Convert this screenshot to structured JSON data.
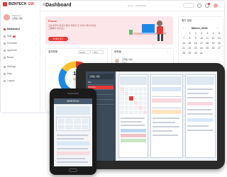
{
  "app": {
    "brand": "BIZNTECH",
    "brand_accent": "GW",
    "page_title": "Dashboard",
    "breadcrumb": "Home  >  Dashboard"
  },
  "user": {
    "line1": "Welcome",
    "line2": "김태훈 과장"
  },
  "sidebar": {
    "items": [
      {
        "label": "Dashboard",
        "active": true
      },
      {
        "label": "Mail",
        "badge": "5"
      },
      {
        "label": "Schedule"
      },
      {
        "label": "Approval"
      },
      {
        "label": "Board"
      },
      {
        "label": "Settings"
      },
      {
        "label": "Help"
      },
      {
        "label": "Logout"
      }
    ]
  },
  "promo": {
    "title": "Focus",
    "subtitle": "오늘 하루의 일정과 결재, 메일을 한 곳에서 확인하세요.",
    "subtitle2": "그룹웨어 대시보드",
    "button": "자세히 보기"
  },
  "calendar": {
    "heading": "월간 일정",
    "month": "March, 2021",
    "days": [
      "",
      "1",
      "2",
      "3",
      "4",
      "5",
      "6",
      "7",
      "8",
      "9",
      "10",
      "11",
      "12",
      "13",
      "14",
      "15",
      "16",
      "17",
      "18",
      "19",
      "20",
      "21",
      "22",
      "23",
      "24",
      "25",
      "26",
      "27",
      "28",
      "29",
      "30",
      "31"
    ]
  },
  "donut_card": {
    "title": "결재현황",
    "select1": "August",
    "select2": "2021",
    "center_value": "16",
    "center_label": "미결재",
    "segments": [
      {
        "color": "#e53935",
        "value": 35
      },
      {
        "color": "#43a047",
        "value": 25
      },
      {
        "color": "#1e88e5",
        "value": 25
      },
      {
        "color": "#fbc02d",
        "value": 15
      }
    ]
  },
  "users_card": {
    "title": "팀원들",
    "users": [
      {
        "name": "조재훈 과장",
        "sub": "개발팀"
      },
      {
        "name": "김민지 대리",
        "sub": "디자인팀"
      },
      {
        "name": "이수진 사원",
        "sub": "영업팀"
      }
    ]
  },
  "mobile": {
    "header": "BIZNTECH"
  },
  "colors": {
    "accent": "#e53935",
    "tablet_sidebar": "#3d4a5a"
  }
}
